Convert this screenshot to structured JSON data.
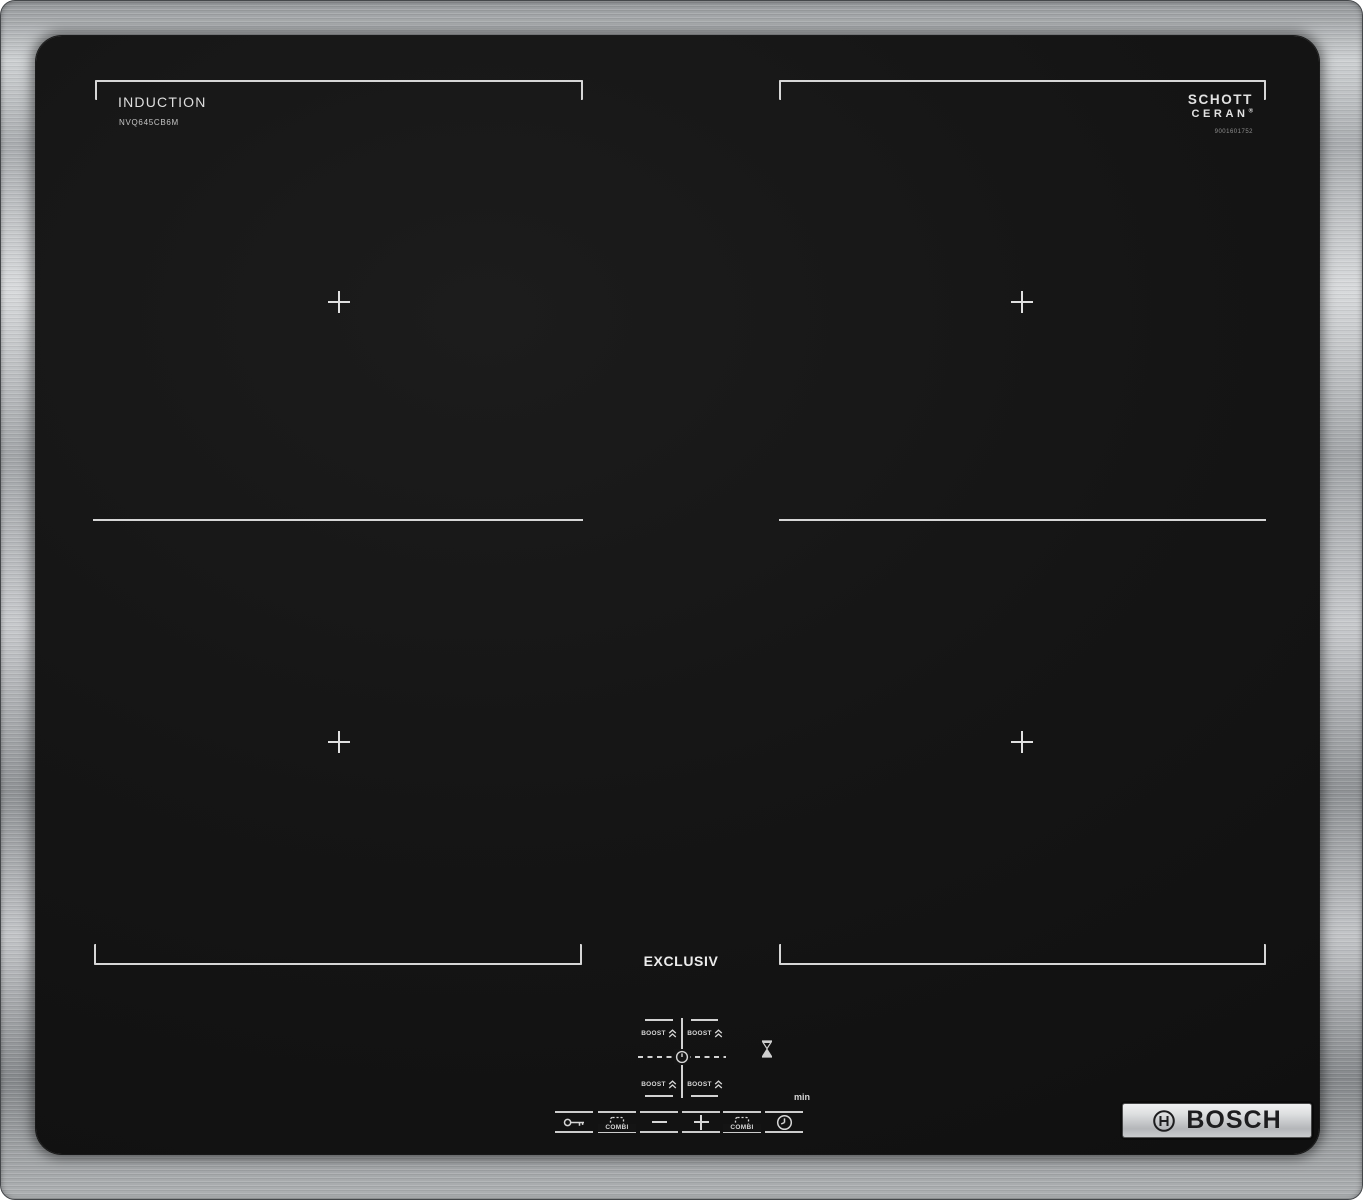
{
  "device": {
    "type_label": "INDUCTION",
    "model": "NVQ645CB6M",
    "serial": "9001601752",
    "series_label": "EXCLUSIV",
    "brand": "BOSCH"
  },
  "glass_brand": {
    "line1": "SCHOTT",
    "line2": "CERAN",
    "registered": "®"
  },
  "controls": {
    "boost_label": "BOOST",
    "combi_label": "COMBI",
    "min_label": "min",
    "buttons": [
      {
        "name": "child-lock",
        "icon": "key-icon"
      },
      {
        "name": "combi-left",
        "icon": "dashed-frame-icon"
      },
      {
        "name": "power-minus",
        "icon": "minus-icon"
      },
      {
        "name": "power-plus",
        "icon": "plus-icon"
      },
      {
        "name": "combi-right",
        "icon": "dashed-frame-icon"
      },
      {
        "name": "timer",
        "icon": "clock-icon"
      }
    ],
    "indicators": [
      {
        "name": "timer-wait",
        "icon": "hourglass-icon"
      },
      {
        "name": "zone-timer-dial",
        "icon": "clock-dial-icon"
      }
    ]
  },
  "zones": {
    "count": 4,
    "marker": "cross",
    "positions": [
      "rear-left",
      "rear-right",
      "front-left",
      "front-right"
    ]
  },
  "colors": {
    "glass": "#141414",
    "marking": "#d6d6d6",
    "steel_light": "#d8dadc",
    "steel_dark": "#85888b",
    "badge_text": "#1d1d1f"
  }
}
